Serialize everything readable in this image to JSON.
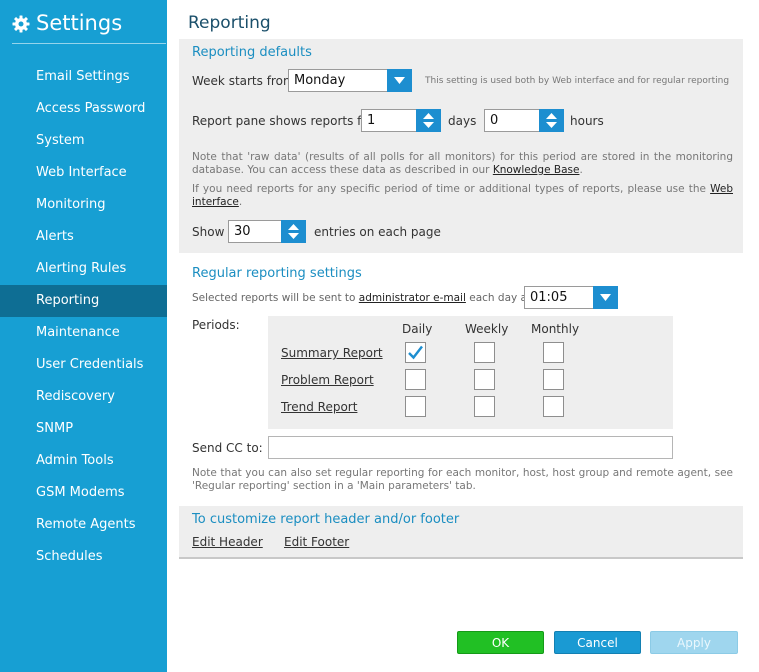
{
  "sidebar": {
    "title": "Settings",
    "icon": "gear-icon",
    "active": "Reporting",
    "items": [
      {
        "label": "Email Settings"
      },
      {
        "label": "Access Password"
      },
      {
        "label": "System"
      },
      {
        "label": "Web Interface"
      },
      {
        "label": "Monitoring"
      },
      {
        "label": "Alerts"
      },
      {
        "label": "Alerting Rules"
      },
      {
        "label": "Reporting"
      },
      {
        "label": "Maintenance"
      },
      {
        "label": "User Credentials"
      },
      {
        "label": "Rediscovery"
      },
      {
        "label": "SNMP"
      },
      {
        "label": "Admin Tools"
      },
      {
        "label": "GSM Modems"
      },
      {
        "label": "Remote Agents"
      },
      {
        "label": "Schedules"
      }
    ]
  },
  "page": {
    "title": "Reporting"
  },
  "defaults": {
    "title": "Reporting defaults",
    "week_label": "Week starts from",
    "week_value": "Monday",
    "week_hint": "This setting is used both by Web interface and for regular reporting",
    "pane_label": "Report pane shows reports for",
    "days_value": "1",
    "days_label": "days",
    "hours_value": "0",
    "hours_label": "hours",
    "note1_text": "Note that 'raw data' (results of all polls for all monitors) for this period are stored in the monitoring database. You can access these data as described in our ",
    "note1_link": "Knowledge Base",
    "note1_end": ".",
    "note2_text": "If you need reports for any specific period of time or additional types of reports, please use the ",
    "note2_link": "Web interface",
    "note2_end": ".",
    "show_label": "Show",
    "show_value": "30",
    "show_suffix": "entries on each page"
  },
  "regular": {
    "title": "Regular reporting settings",
    "sent_prefix": "Selected reports will be sent to ",
    "sent_link": "administrator e-mail",
    "sent_suffix": " each day at",
    "time_value": "01:05",
    "periods_label": "Periods:",
    "columns": [
      "Daily",
      "Weekly",
      "Monthly"
    ],
    "rows": [
      {
        "label": "Summary Report",
        "daily": true,
        "weekly": false,
        "monthly": false
      },
      {
        "label": "Problem Report",
        "daily": false,
        "weekly": false,
        "monthly": false
      },
      {
        "label": "Trend Report",
        "daily": false,
        "weekly": false,
        "monthly": false
      }
    ],
    "cc_label": "Send CC to:",
    "cc_value": "",
    "note": "Note that you can also set regular reporting for each monitor, host, host group and remote agent, see 'Regular reporting' section in a 'Main parameters' tab."
  },
  "customize": {
    "title": "To customize report header and/or footer",
    "edit_header": "Edit Header",
    "edit_footer": "Edit Footer"
  },
  "footer": {
    "ok": "OK",
    "cancel": "Cancel",
    "apply": "Apply"
  },
  "colors": {
    "sidebar_bg": "#179fd3",
    "sidebar_active": "#0e6e94",
    "accent_blue": "#1d8ed0",
    "ok_green": "#21c024",
    "apply_disabled": "#9fd6ee"
  }
}
